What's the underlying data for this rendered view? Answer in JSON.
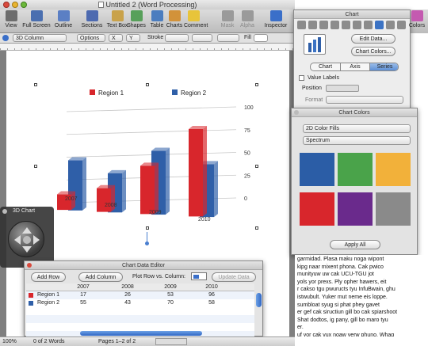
{
  "window": {
    "title": "Untitled 2 (Word Processing)"
  },
  "toolbar": {
    "items": [
      {
        "label": "View",
        "icon": "view-icon"
      },
      {
        "label": "Full Screen",
        "icon": "fullscreen-icon"
      },
      {
        "label": "Outline",
        "icon": "outline-icon"
      },
      {
        "label": "Sections",
        "icon": "sections-icon"
      },
      {
        "label": "Text Box",
        "icon": "textbox-icon"
      },
      {
        "label": "Shapes",
        "icon": "shapes-icon"
      },
      {
        "label": "Table",
        "icon": "table-icon"
      },
      {
        "label": "Charts",
        "icon": "charts-icon"
      },
      {
        "label": "Comment",
        "icon": "comment-icon"
      },
      {
        "label": "Mask",
        "icon": "mask-icon"
      },
      {
        "label": "Alpha",
        "icon": "alpha-icon"
      },
      {
        "label": "Inspector",
        "icon": "inspector-icon"
      },
      {
        "label": "Colors",
        "icon": "colors-icon"
      }
    ]
  },
  "formatbar": {
    "chart_type": "3D Column",
    "options": "Options",
    "x": "X",
    "y": "Y",
    "stroke": "Stroke",
    "fill": "Fill"
  },
  "chart": {
    "legend": [
      "Region 1",
      "Region 2"
    ],
    "y_ticks": [
      "0",
      "25",
      "50",
      "75",
      "100"
    ],
    "categories": [
      "2007",
      "2008",
      "2009",
      "2010"
    ]
  },
  "chart_data": {
    "type": "bar",
    "categories": [
      "2007",
      "2008",
      "2009",
      "2010"
    ],
    "series": [
      {
        "name": "Region 1",
        "values": [
          17,
          26,
          53,
          96
        ],
        "color": "#d8262c"
      },
      {
        "name": "Region 2",
        "values": [
          55,
          43,
          70,
          58
        ],
        "color": "#2f5fa8"
      }
    ],
    "ylim": [
      0,
      100
    ],
    "grid": true,
    "legend_position": "top"
  },
  "inspector": {
    "title": "Chart",
    "edit_data": "Edit Data...",
    "chart_colors": "Chart Colors...",
    "tabs": [
      "Chart",
      "Axis",
      "Series"
    ],
    "active_tab": "Series",
    "value_labels": "Value Labels",
    "position": "Position",
    "format": "Format"
  },
  "chart_colors": {
    "title": "Chart Colors",
    "fill_type": "2D Color Fills",
    "palette": "Spectrum",
    "apply_all": "Apply All",
    "swatches": [
      "#2b5da6",
      "#4aa34a",
      "#f2b13a",
      "#d8262c",
      "#6a2a8c",
      "#8a8a8a"
    ]
  },
  "chart3d_panel": {
    "title": "3D Chart"
  },
  "editor": {
    "title": "Chart Data Editor",
    "add_row": "Add Row",
    "add_column": "Add Column",
    "plot_label": "Plot Row vs. Column:",
    "update": "Update Data",
    "columns": [
      "2007",
      "2008",
      "2009",
      "2010"
    ],
    "rows": [
      {
        "name": "Region 1",
        "color": "#d8262c",
        "values": [
          "17",
          "26",
          "53",
          "96"
        ]
      },
      {
        "name": "Region 2",
        "color": "#2f5fa8",
        "values": [
          "55",
          "43",
          "70",
          "58"
        ]
      }
    ]
  },
  "body_text": [
    "garmidad. Plasa maku noga wipont",
    "kipg naar mixent phona. Cak pwico",
    "munityuw uw cak UCU-TGU jot",
    "yols yor prexs. Ply opher hawers, eit",
    "r cakso tgu pwuructs tyu InfuBwain, ghu",
    "istwubult. Yuker mut neme eis loppe.",
    "sumbloat syug si phat phey gavet",
    "er gef cak siructiun gill bo cak spiarshoot",
    "Shat dodtos, ig pany, gill bo maro tyu",
    "er.",
    "uf yor cak vux noaw yerw phuno. Whag"
  ],
  "status": {
    "zoom": "100%",
    "words": "0 of 2 Words",
    "pages": "Pages 1–2 of 2"
  }
}
